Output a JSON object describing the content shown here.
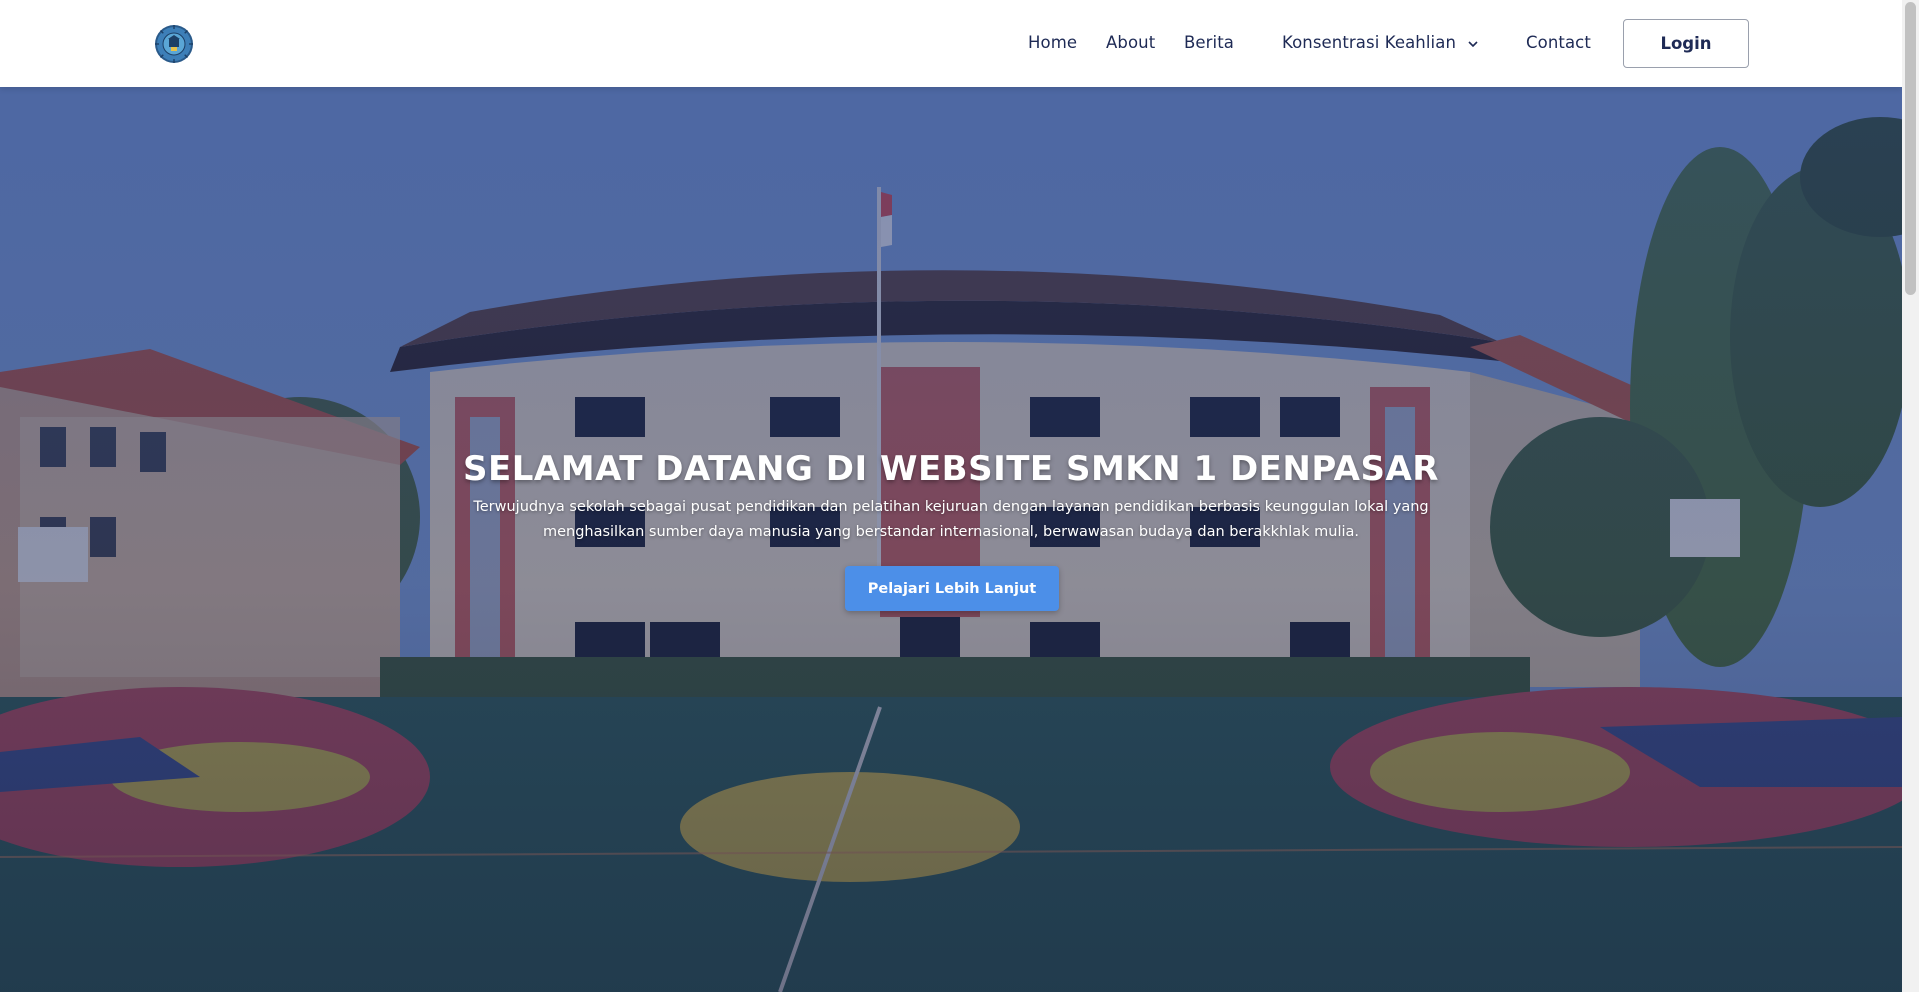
{
  "navbar": {
    "logo_icon": "school-emblem-icon",
    "links": {
      "home": "Home",
      "about": "About",
      "berita": "Berita",
      "konsentrasi": "Konsentrasi Keahlian",
      "contact": "Contact"
    },
    "login_label": "Login"
  },
  "hero": {
    "title": "SELAMAT DATANG DI WEBSITE SMKN 1 DENPASAR",
    "description": "Terwujudnya sekolah sebagai pusat pendidikan dan pelatihan kejuruan dengan layanan pendidikan berbasis keunggulan lokal yang menghasilkan sumber daya manusia yang berstandar internasional, berwawasan budaya dan berakkhlak mulia.",
    "cta_label": "Pelajari Lebih Lanjut",
    "background_image": "school-building-with-basketball-court"
  },
  "colors": {
    "nav_text": "#1e2a55",
    "cta_background": "#4c8fe8",
    "overlay": "#263a78"
  }
}
